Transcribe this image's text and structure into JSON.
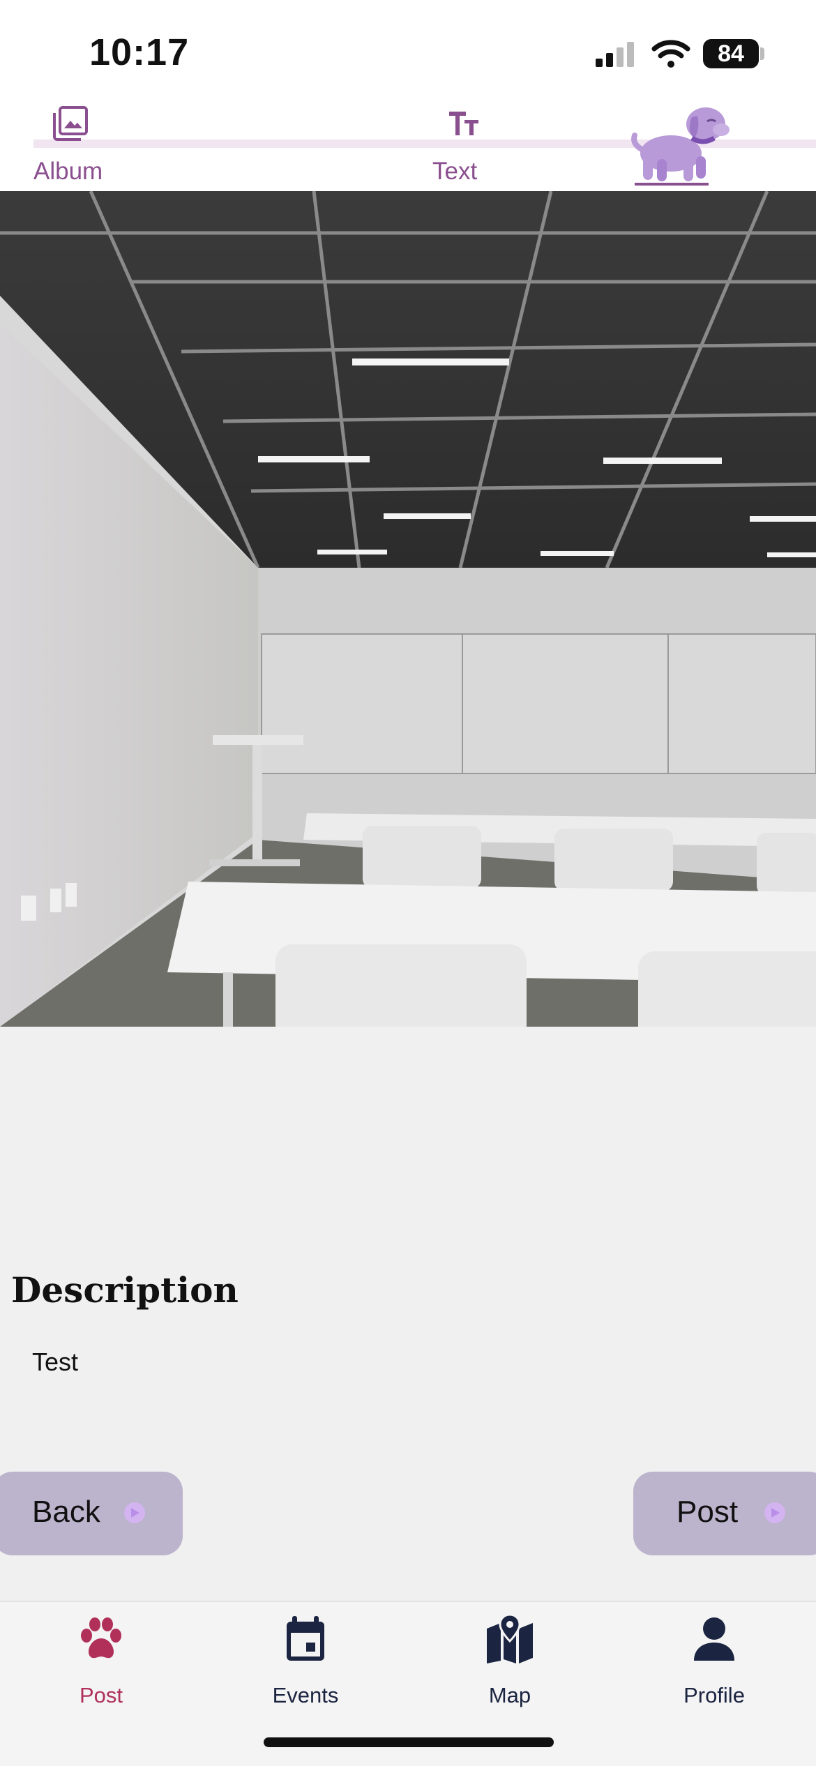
{
  "status_bar": {
    "time": "10:17",
    "battery": "84",
    "icons": [
      "signal-icon",
      "wifi-icon",
      "battery-icon"
    ]
  },
  "header": {
    "tabs": [
      {
        "label": "Album",
        "icon": "album-icon"
      },
      {
        "label": "Text",
        "icon": "text-format-icon"
      }
    ],
    "mascot": "dog-icon",
    "accent_color": "#8a4f8e"
  },
  "photo": {
    "subject": "classroom-photo"
  },
  "description": {
    "title": "Description",
    "text": "Test"
  },
  "actions": {
    "back_label": "Back",
    "post_label": "Post",
    "button_color": "#bcb3cd"
  },
  "bottom_nav": {
    "items": [
      {
        "label": "Post",
        "icon": "paw-icon",
        "active": true
      },
      {
        "label": "Events",
        "icon": "calendar-icon",
        "active": false
      },
      {
        "label": "Map",
        "icon": "map-icon",
        "active": false
      },
      {
        "label": "Profile",
        "icon": "person-icon",
        "active": false
      }
    ],
    "active_color": "#b0305a",
    "inactive_color": "#1b2440"
  }
}
